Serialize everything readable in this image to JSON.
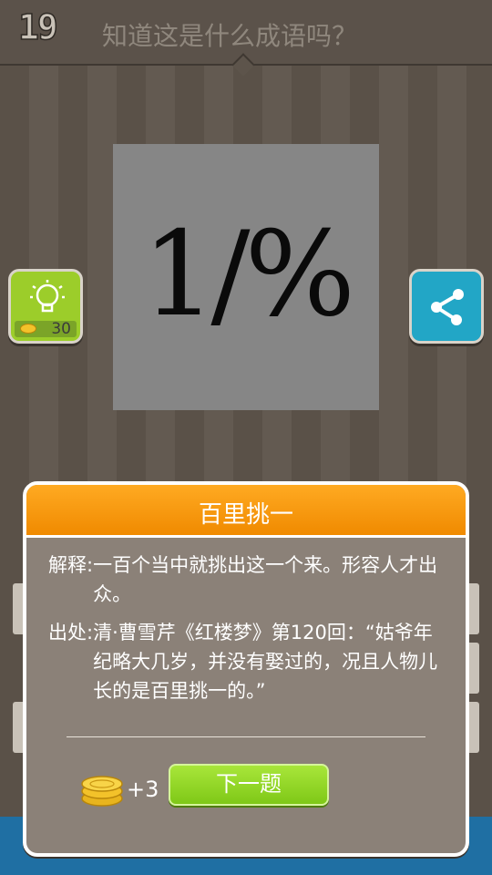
{
  "header": {
    "level": "19",
    "title": "知道这是什么成语吗？"
  },
  "puzzle": {
    "text": "1/%"
  },
  "hint": {
    "cost": "30",
    "icon": "lightbulb-icon"
  },
  "share": {
    "icon": "share-icon"
  },
  "dialog": {
    "title": "百里挑一",
    "explain_label": "解释:",
    "explain_text": "一百个当中就挑出这一个来。形容人才出众。",
    "source_label": "出处:",
    "source_text": "清·曹雪芹《红楼梦》第120回：“姑爷年纪略大几岁，并没有娶过的，况且人物儿长的是百里挑一的。”",
    "reward": "+3",
    "next_label": "下一题"
  },
  "colors": {
    "accent": "#f08a00",
    "next": "#8fd626",
    "share": "#22a6c6",
    "hint": "#9ccd2a"
  }
}
